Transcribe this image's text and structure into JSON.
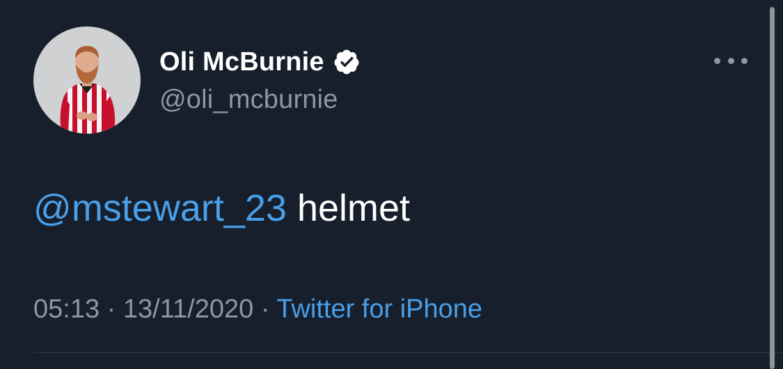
{
  "tweet": {
    "author": {
      "display_name": "Oli McBurnie",
      "handle": "@oli_mcburnie",
      "verified": true,
      "avatar_icon": "profile-photo"
    },
    "text": {
      "mention": "@mstewart_23",
      "body": "helmet"
    },
    "meta": {
      "time": "05:13",
      "separator": "·",
      "date": "13/11/2020",
      "source": "Twitter for iPhone"
    },
    "menu_icon": "more-icon"
  },
  "colors": {
    "background": "#161f2b",
    "text_primary": "#ffffff",
    "text_secondary": "#8b98a5",
    "link": "#4a9fe8"
  }
}
